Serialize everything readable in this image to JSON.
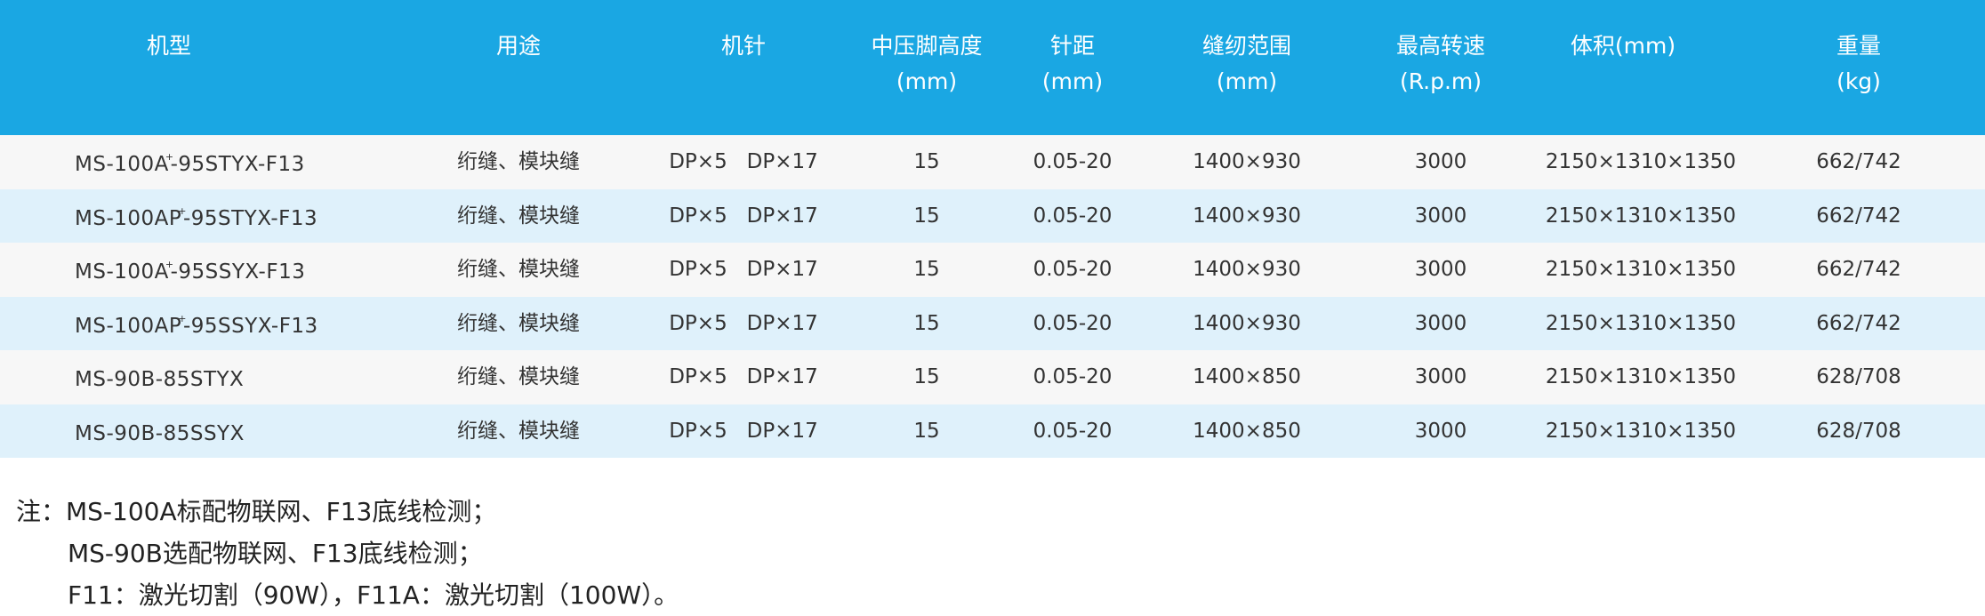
{
  "table": {
    "headers": [
      {
        "line1": "机型",
        "line2": ""
      },
      {
        "line1": "用途",
        "line2": ""
      },
      {
        "line1": "机针",
        "line2": ""
      },
      {
        "line1": "中压脚高度",
        "line2": "(mm)"
      },
      {
        "line1": "针距",
        "line2": "(mm)"
      },
      {
        "line1": "缝纫范围",
        "line2": "(mm)"
      },
      {
        "line1": "最高转速",
        "line2": "(R.p.m)"
      },
      {
        "line1": "体积(mm)",
        "line2": ""
      },
      {
        "line1": "重量",
        "line2": "(kg)"
      }
    ],
    "rows": [
      {
        "model": "MS-100A",
        "model_sup": "+",
        "model_rest": "-95STYX-F13",
        "use": "绗缝、模块缝",
        "needle": "DP×5   DP×17",
        "foot": "15",
        "stitch": "0.05-20",
        "range": "1400×930",
        "speed": "3000",
        "volume": "2150×1310×1350",
        "weight": "662/742"
      },
      {
        "model": "MS-100AP",
        "model_sup": "+",
        "model_rest": "-95STYX-F13",
        "use": "绗缝、模块缝",
        "needle": "DP×5   DP×17",
        "foot": "15",
        "stitch": "0.05-20",
        "range": "1400×930",
        "speed": "3000",
        "volume": "2150×1310×1350",
        "weight": "662/742"
      },
      {
        "model": "MS-100A",
        "model_sup": "+",
        "model_rest": "-95SSYX-F13",
        "use": "绗缝、模块缝",
        "needle": "DP×5   DP×17",
        "foot": "15",
        "stitch": "0.05-20",
        "range": "1400×930",
        "speed": "3000",
        "volume": "2150×1310×1350",
        "weight": "662/742"
      },
      {
        "model": "MS-100AP",
        "model_sup": "+",
        "model_rest": "-95SSYX-F13",
        "use": "绗缝、模块缝",
        "needle": "DP×5   DP×17",
        "foot": "15",
        "stitch": "0.05-20",
        "range": "1400×930",
        "speed": "3000",
        "volume": "2150×1310×1350",
        "weight": "662/742"
      },
      {
        "model": "MS-90B-85STYX",
        "model_sup": "",
        "model_rest": "",
        "use": "绗缝、模块缝",
        "needle": "DP×5   DP×17",
        "foot": "15",
        "stitch": "0.05-20",
        "range": "1400×850",
        "speed": "3000",
        "volume": "2150×1310×1350",
        "weight": "628/708"
      },
      {
        "model": "MS-90B-85SSYX",
        "model_sup": "",
        "model_rest": "",
        "use": "绗缝、模块缝",
        "needle": "DP×5   DP×17",
        "foot": "15",
        "stitch": "0.05-20",
        "range": "1400×850",
        "speed": "3000",
        "volume": "2150×1310×1350",
        "weight": "628/708"
      }
    ]
  },
  "notes": {
    "line1": "注：MS-100A标配物联网、F13底线检测；",
    "line2": "MS-90B选配物联网、F13底线检测；",
    "line3": "F11：激光切割（90W），F11A：激光切割（100W）。"
  },
  "colors": {
    "header_bg": "#1aa7e3",
    "row_odd": "#f7f7f7",
    "row_even": "#dff1fb"
  }
}
